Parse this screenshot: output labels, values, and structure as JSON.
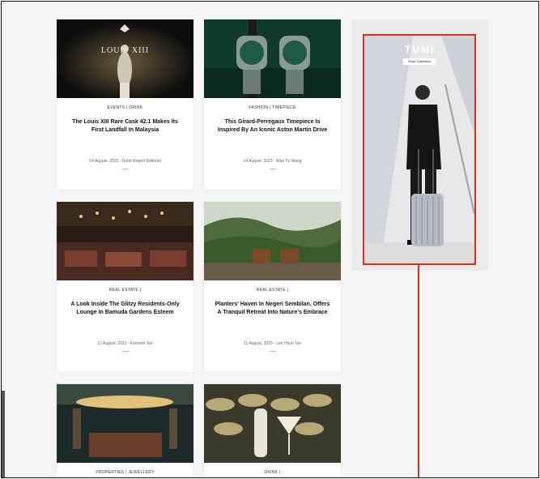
{
  "articles": [
    {
      "category": "EVENTS | DRINK",
      "title": "The Louis XIII Rare Cask 42.1 Makes Its First Landfall In Malaysia",
      "meta": "14 August, 2023 · Robb Report Editorial",
      "image_text": "LOUIS XIII"
    },
    {
      "category": "FASHION | TIMEPIECE",
      "title": "This Girard-Perregaux Timepiece Is Inspired By An Iconic Aston Martin Drive",
      "meta": "14 August, 2023 · Wan Yu Wang"
    },
    {
      "category": "REAL ESTATE |",
      "title": "A Look Inside The Glitzy Residents-Only Lounge In Bamuda Gardens Esteem",
      "meta": "12 August, 2023 · Kenneth Tan"
    },
    {
      "category": "REAL ESTATE |",
      "title": "Planters' Haven In Negeri Sembilan, Offers A Tranquil Retreat Into Nature's Embrace",
      "meta": "11 August, 2023 · Lee Hsun Tan"
    },
    {
      "category": "PROPERTIES | JEWELLERY",
      "title": "",
      "meta": ""
    },
    {
      "category": "DRINK |",
      "title": "",
      "meta": ""
    }
  ],
  "ad": {
    "brand": "TUMI",
    "button": "Shop Collection"
  },
  "colors": {
    "accent": "#d4321a",
    "background": "#f5f5f5"
  }
}
